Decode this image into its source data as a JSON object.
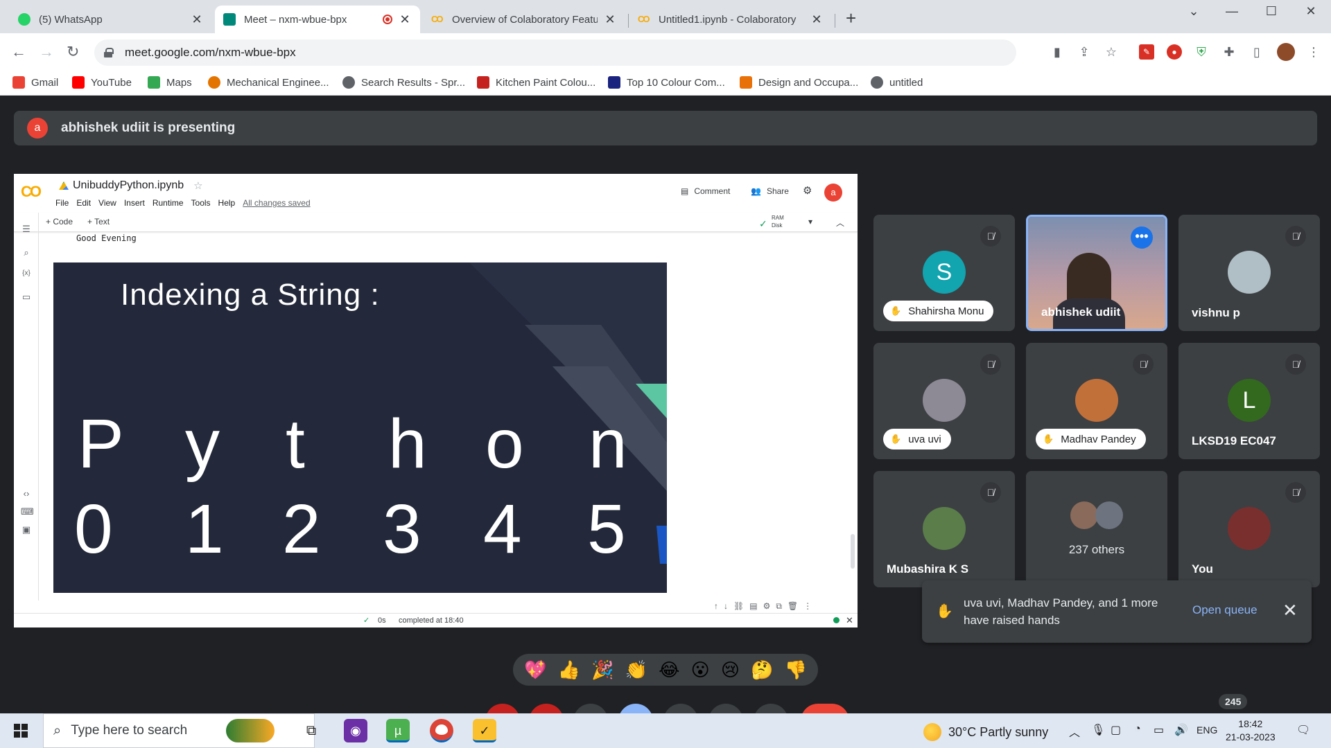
{
  "browser": {
    "tabs": [
      {
        "title": "(5) WhatsApp",
        "favicon": "whatsapp-icon",
        "color": "#25d366"
      },
      {
        "title": "Meet – nxm-wbue-bpx",
        "favicon": "meet-icon",
        "color": "#00897b",
        "recording": true
      },
      {
        "title": "Overview of Colaboratory Features",
        "favicon": "colab-icon",
        "color": "#f9ab00"
      },
      {
        "title": "Untitled1.ipynb - Colaboratory",
        "favicon": "colab-icon",
        "color": "#f9ab00"
      }
    ],
    "url": "meet.google.com/nxm-wbue-bpx",
    "bookmarks": [
      {
        "label": "Gmail",
        "color": "#ea4335"
      },
      {
        "label": "YouTube",
        "color": "#ff0000"
      },
      {
        "label": "Maps",
        "color": "#34a853"
      },
      {
        "label": "Mechanical Enginee...",
        "color": "#e37400"
      },
      {
        "label": "Search Results - Spr...",
        "color": "#5f6368"
      },
      {
        "label": "Kitchen Paint Colou...",
        "color": "#c5221f"
      },
      {
        "label": "Top 10 Colour Com...",
        "color": "#1a237e"
      },
      {
        "label": "Design and Occupa...",
        "color": "#e8710a"
      },
      {
        "label": "untitled",
        "color": "#5f6368"
      }
    ]
  },
  "meet": {
    "presenting_initial": "a",
    "presenting_text": "abhishek udiit is presenting",
    "participants": [
      {
        "name": "Shahirsha Monu",
        "initial": "S",
        "avatar_color": "#12a4af",
        "hand_raised": true,
        "muted": true
      },
      {
        "name": "abhishek udiit",
        "speaking": true
      },
      {
        "name": "vishnu p",
        "muted": true
      },
      {
        "name": "uva uvi",
        "hand_raised": true,
        "muted": true
      },
      {
        "name": "Madhav Pandey",
        "hand_raised": true,
        "muted": true
      },
      {
        "name": "LKSD19 EC047",
        "initial": "L",
        "avatar_color": "#33691e",
        "muted": true
      },
      {
        "name": "Mubashira K S",
        "muted": true
      },
      {
        "name": "237 others"
      },
      {
        "name": "You",
        "muted": true
      }
    ],
    "toast": {
      "message": "uva uvi, Madhav Pandey, and 1 more have raised hands",
      "action": "Open queue"
    },
    "reactions": [
      "💖",
      "👍",
      "🎉",
      "👏",
      "😂",
      "😮",
      "😢",
      "🤔",
      "👎"
    ],
    "participant_count": "245"
  },
  "colab": {
    "notebook_title": "UnibuddyPython.ipynb",
    "menu": [
      "File",
      "Edit",
      "View",
      "Insert",
      "Runtime",
      "Tools",
      "Help"
    ],
    "saved_status": "All changes saved",
    "comment_label": "Comment",
    "share_label": "Share",
    "user_initial": "a",
    "add_code": "+ Code",
    "add_text": "+ Text",
    "ram_label": "RAM",
    "disk_label": "Disk",
    "output_text": "Good Evening",
    "slide": {
      "title": "Indexing a String :",
      "letters": [
        "P",
        "y",
        "t",
        "h",
        "o",
        "n"
      ],
      "indices": [
        "0",
        "1",
        "2",
        "3",
        "4",
        "5"
      ]
    },
    "status_time": "0s",
    "status_text": "completed at 18:40"
  },
  "taskbar": {
    "search_placeholder": "Type here to search",
    "weather": "30°C  Partly sunny",
    "language": "ENG",
    "time": "18:42",
    "date": "21-03-2023"
  }
}
